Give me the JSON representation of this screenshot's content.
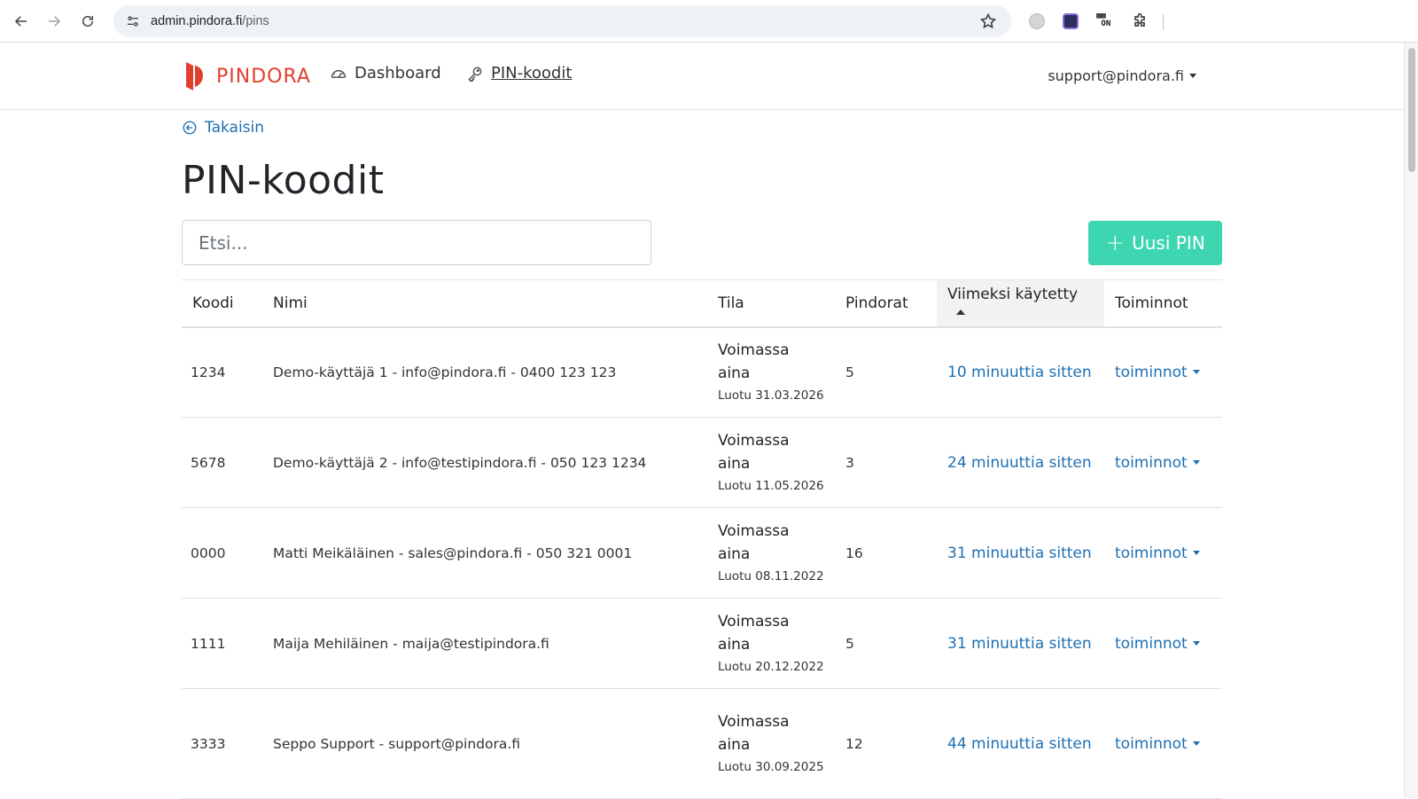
{
  "browser": {
    "url_host": "admin.pindora.fi",
    "url_path": "/pins"
  },
  "header": {
    "brand": "PINDORA",
    "nav": [
      {
        "label": "Dashboard",
        "icon": "speedometer-icon"
      },
      {
        "label": "PIN-koodit",
        "icon": "key-icon"
      }
    ],
    "user": "support@pindora.fi"
  },
  "main": {
    "back_label": "Takaisin",
    "title": "PIN-koodit",
    "search_placeholder": "Etsi...",
    "new_button": "Uusi PIN",
    "columns": [
      "Koodi",
      "Nimi",
      "Tila",
      "Pindorat",
      "Viimeksi käytetty",
      "Toiminnot"
    ],
    "sorted_column": "Viimeksi käytetty",
    "rows": [
      {
        "code": "1234",
        "name": "Demo-käyttäjä 1 - info@pindora.fi - 0400 123 123",
        "state": "Voimassa aina",
        "created": "Luotu 31.03.2026",
        "count": "5",
        "last_used": "10 minuuttia sitten",
        "actions": "toiminnot"
      },
      {
        "code": "5678",
        "name": "Demo-käyttäjä 2 - info@testipindora.fi - 050 123 1234",
        "state": "Voimassa aina",
        "created": "Luotu 11.05.2026",
        "count": "3",
        "last_used": "24 minuuttia sitten",
        "actions": "toiminnot"
      },
      {
        "code": "0000",
        "name": "Matti Meikäläinen - sales@pindora.fi - 050 321 0001",
        "state": "Voimassa aina",
        "created": "Luotu 08.11.2022",
        "count": "16",
        "last_used": "31 minuuttia sitten",
        "actions": "toiminnot"
      },
      {
        "code": "1111",
        "name": "Maija Mehiläinen - maija@testipindora.fi",
        "state": "Voimassa aina",
        "created": "Luotu 20.12.2022",
        "count": "5",
        "last_used": "31 minuuttia sitten",
        "actions": "toiminnot"
      },
      {
        "code": "3333",
        "name": "Seppo Support - support@pindora.fi",
        "state": "Voimassa aina",
        "created": "Luotu 30.09.2025",
        "count": "12",
        "last_used": "44 minuuttia sitten",
        "actions": "toiminnot"
      }
    ]
  },
  "colors": {
    "brand": "#e0402e",
    "accent_button": "#3dd6b1",
    "link": "#1f6fb2"
  }
}
